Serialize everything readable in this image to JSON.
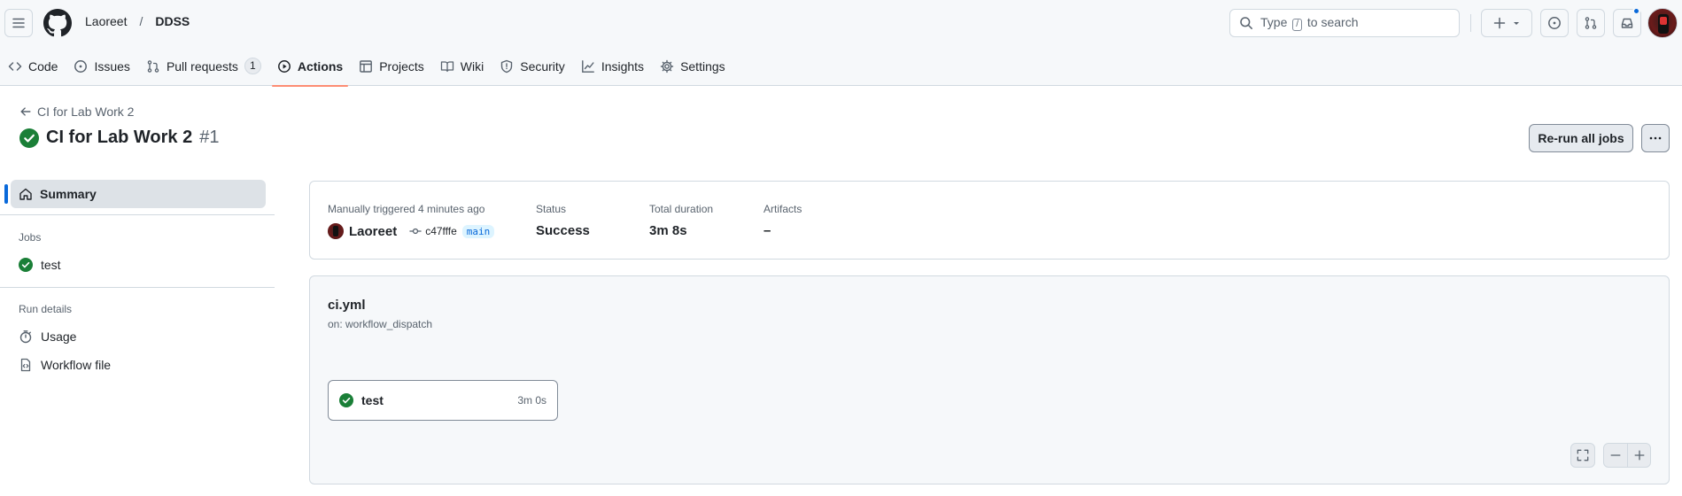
{
  "header": {
    "owner": "Laoreet",
    "separator": "/",
    "repo": "DDSS",
    "search": {
      "prefix": "Type",
      "key": "/",
      "suffix": "to search"
    }
  },
  "tabs": [
    {
      "label": "Code",
      "icon": "code-icon"
    },
    {
      "label": "Issues",
      "icon": "issue-icon"
    },
    {
      "label": "Pull requests",
      "icon": "pull-request-icon",
      "count": "1"
    },
    {
      "label": "Actions",
      "icon": "play-icon",
      "selected": true
    },
    {
      "label": "Projects",
      "icon": "table-icon"
    },
    {
      "label": "Wiki",
      "icon": "book-icon"
    },
    {
      "label": "Security",
      "icon": "shield-icon"
    },
    {
      "label": "Insights",
      "icon": "graph-icon"
    },
    {
      "label": "Settings",
      "icon": "gear-icon"
    }
  ],
  "run": {
    "back_label": "CI for Lab Work 2",
    "title": "CI for Lab Work 2",
    "number": "#1",
    "rerun_label": "Re-run all jobs"
  },
  "sidebar": {
    "summary": "Summary",
    "jobs_heading": "Jobs",
    "jobs": [
      "test"
    ],
    "details_heading": "Run details",
    "details": [
      "Usage",
      "Workflow file"
    ]
  },
  "summary_card": {
    "trigger_label": "Manually triggered 4 minutes ago",
    "actor": "Laoreet",
    "commit": "c47fffe",
    "branch": "main",
    "status_label": "Status",
    "status_value": "Success",
    "duration_label": "Total duration",
    "duration_value": "3m 8s",
    "artifacts_label": "Artifacts",
    "artifacts_value": "–"
  },
  "workflow": {
    "file": "ci.yml",
    "trigger": "on: workflow_dispatch",
    "job": {
      "name": "test",
      "duration": "3m 0s"
    }
  },
  "colors": {
    "accent": "#0969da",
    "success": "#1a7f37",
    "tab_underline": "#fd8c73"
  }
}
